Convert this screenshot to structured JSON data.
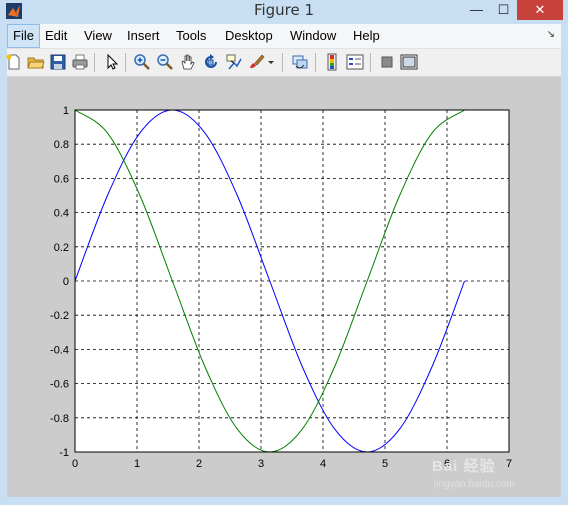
{
  "window": {
    "title": "Figure 1",
    "controls": {
      "minimize": "—",
      "maximize": "☐",
      "close": "✕"
    }
  },
  "menu": {
    "items": [
      {
        "label": "File",
        "active": true
      },
      {
        "label": "Edit"
      },
      {
        "label": "View"
      },
      {
        "label": "Insert"
      },
      {
        "label": "Tools"
      },
      {
        "label": "Desktop"
      },
      {
        "label": "Window"
      },
      {
        "label": "Help"
      }
    ],
    "overflow_arrow": "↘"
  },
  "toolbar": {
    "buttons": [
      "new-figure-icon",
      "open-file-icon",
      "save-icon",
      "print-icon",
      "edit-plot-arrow-icon",
      "zoom-in-icon",
      "zoom-out-icon",
      "pan-hand-icon",
      "rotate-3d-icon",
      "data-cursor-icon",
      "brush-icon",
      "brush-dropdown-arrow-icon",
      "link-plot-icon",
      "insert-colorbar-icon",
      "insert-legend-icon",
      "hide-plot-tools-icon",
      "show-plot-tools-icon"
    ]
  },
  "chart_data": {
    "type": "line",
    "title": "",
    "xlabel": "",
    "ylabel": "",
    "xlim": [
      0,
      7
    ],
    "ylim": [
      -1,
      1
    ],
    "xticks": [
      "0",
      "1",
      "2",
      "3",
      "4",
      "5",
      "6",
      "7"
    ],
    "yticks": [
      "1",
      "0.8",
      "0.6",
      "0.4",
      "0.2",
      "0",
      "-0.2",
      "-0.4",
      "-0.6",
      "-0.8",
      "-1"
    ],
    "grid": true,
    "grid_style": "dashed",
    "series": [
      {
        "color": "#0000ff",
        "x": [
          0,
          0.5236,
          1.0472,
          1.5708,
          2.0944,
          2.618,
          3.1416,
          3.6652,
          4.1888,
          4.7124,
          5.236,
          5.7596,
          6.2832
        ],
        "y": [
          0,
          0.5,
          0.866,
          1,
          0.866,
          0.5,
          0,
          -0.5,
          -0.866,
          -1,
          -0.866,
          -0.5,
          0
        ]
      },
      {
        "color": "#008000",
        "x": [
          0,
          0.5236,
          1.0472,
          1.5708,
          2.0944,
          2.618,
          3.1416,
          3.6652,
          4.1888,
          4.7124,
          5.236,
          5.7596,
          6.2832
        ],
        "y": [
          1,
          0.866,
          0.5,
          0,
          -0.5,
          -0.866,
          -1,
          -0.866,
          -0.5,
          0,
          0.5,
          0.866,
          1
        ]
      }
    ]
  },
  "watermark": {
    "logo": "Bai 经验",
    "url": "jingyan.baidu.com"
  }
}
